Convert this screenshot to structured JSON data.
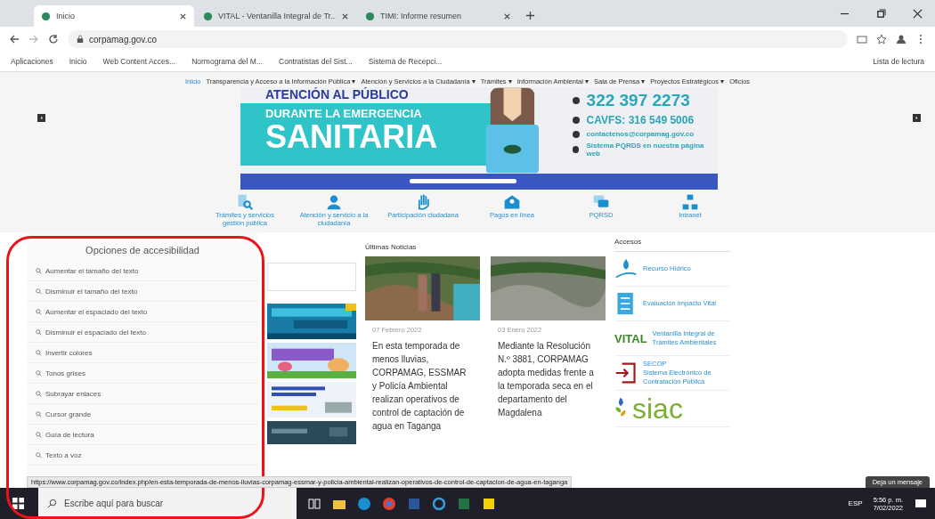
{
  "browser": {
    "tabs": [
      {
        "title": "Inicio",
        "selected": true
      },
      {
        "title": "VITAL - Ventanilla Integral de Tr...",
        "selected": false
      },
      {
        "title": "TIMI: Informe resumen",
        "selected": false
      }
    ],
    "url": "corpamag.gov.co",
    "bookmarks": [
      "Aplicaciones",
      "Inicio",
      "Web Content Acces...",
      "Normograma del M...",
      "Contratistas del Sist...",
      "Sistema de Recepci..."
    ],
    "reading_list": "Lista de lectura"
  },
  "nav": [
    {
      "label": "Inicio",
      "selected": true
    },
    {
      "label": "Transparencia y Acceso a la Información Pública ▾",
      "selected": false
    },
    {
      "label": "Atención y Servicios a la Ciudadanía ▾",
      "selected": false
    },
    {
      "label": "Trámites ▾",
      "selected": false
    },
    {
      "label": "Información Ambiental ▾",
      "selected": false
    },
    {
      "label": "Sala de Prensa ▾",
      "selected": false
    },
    {
      "label": "Proyectos Estratégicos ▾",
      "selected": false
    },
    {
      "label": "Oficios",
      "selected": false
    }
  ],
  "banner": {
    "heading": "ATENCIÓN AL PÚBLICO",
    "line_1": "DURANTE LA EMERGENCIA",
    "line_2": "SANITARIA",
    "phone": "322 397 2273",
    "cavfs": "CAVFS: 316 549 5006",
    "email": "contactenos@corpamag.gov.co",
    "pqrds": "Sistema PQRDS en nuestra página web"
  },
  "services": [
    {
      "label": "Trámites y servicios gestión pública"
    },
    {
      "label": "Atención y servicio a la ciudadanía"
    },
    {
      "label": "Participación ciudadana"
    },
    {
      "label": "Pagos en línea"
    },
    {
      "label": "PQRSD"
    },
    {
      "label": "Intranet"
    }
  ],
  "accessibility": {
    "title": "Opciones de accesibilidad",
    "options": [
      "Aumentar el tamaño del texto",
      "Disminuir el tamaño del texto",
      "Aumentar el espaciado del texto",
      "Disminuir el espaciado del texto",
      "Invertir colores",
      "Tonos grises",
      "Subrayar enlaces",
      "Cursor grande",
      "Guía de lectura",
      "Texto a voz"
    ]
  },
  "news": {
    "title": "Últimas Noticias",
    "items": [
      {
        "date": "07 Febrero 2022",
        "text": "En esta temporada de menos lluvias, CORPAMAG, ESSMAR y Policía Ambiental realizan operativos de control de captación de agua en Taganga"
      },
      {
        "date": "03 Enero 2022",
        "text": "Mediante la Resolución N.º 3881, CORPAMAG adopta medidas frente a la temporada seca en el departamento del Magdalena"
      }
    ]
  },
  "access": {
    "title": "Accesos",
    "items": [
      {
        "kind": "icon",
        "lines": [
          "Recurso Hídrico"
        ]
      },
      {
        "kind": "list",
        "lines": [
          "Evaluación Impacto Vital"
        ]
      },
      {
        "kind": "vital",
        "logo": "VITAL",
        "lines": [
          "Ventanilla Integral de",
          "Trámites Ambientales"
        ]
      },
      {
        "kind": "secop",
        "lines": [
          "SECOP",
          "Sistema Electrónico de",
          "Contratación Pública"
        ]
      },
      {
        "kind": "siac",
        "logo": "siac"
      }
    ]
  },
  "status_url": "https://www.corpamag.gov.co/index.php/en-esta-temporada-de-menos-lluvias-corpamag-essmar-y-policia-ambiental-realizan-operativos-de-control-de-captacion-de-agua-en-taganga",
  "chat": "Deja un mensaje",
  "taskbar": {
    "search_placeholder": "Escribe aquí para buscar",
    "language": "ESP",
    "time": "5:56 p. m.",
    "date": "7/02/2022"
  }
}
